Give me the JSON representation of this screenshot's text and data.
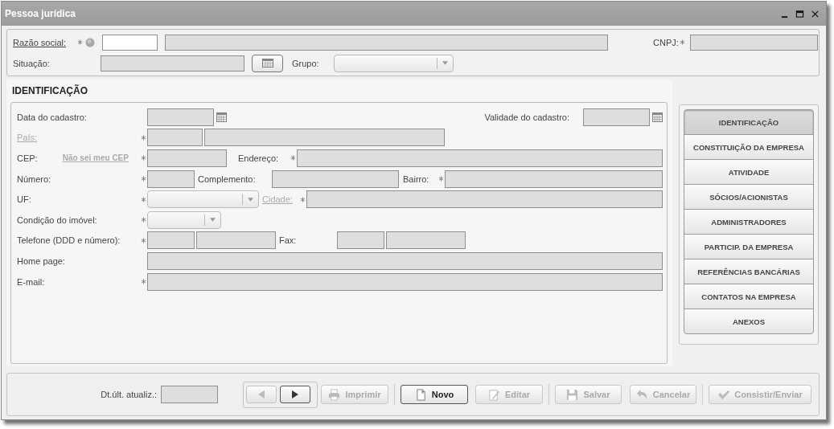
{
  "window": {
    "title": "Pessoa jurídica"
  },
  "header": {
    "razao_social": {
      "label": "Razão social:",
      "link": true,
      "disabled": false,
      "required": true,
      "fields": [
        {
          "kind": "text",
          "disabled": false
        },
        {
          "kind": "text",
          "disabled": true
        }
      ]
    },
    "cnpj": {
      "label": "CNPJ:",
      "link": false,
      "disabled": false,
      "required": true,
      "fields": [
        {
          "kind": "text",
          "disabled": true
        }
      ]
    },
    "situacao": {
      "label": "Situação:",
      "link": false,
      "disabled": false,
      "required": false,
      "fields": [
        {
          "kind": "text",
          "disabled": true
        }
      ]
    },
    "grupo": {
      "label": "Grupo:",
      "link": false,
      "disabled": false,
      "required": false,
      "fields": [
        {
          "kind": "dropdown",
          "disabled": true
        }
      ]
    }
  },
  "identification": {
    "title": "IDENTIFICAÇÃO",
    "registration_date": {
      "label": "Data do cadastro:",
      "link": false,
      "disabled": false,
      "required": false,
      "fields": [
        {
          "kind": "date",
          "disabled": true
        }
      ]
    },
    "validity_date": {
      "label": "Validade do cadastro:",
      "link": false,
      "disabled": false,
      "required": false,
      "fields": [
        {
          "kind": "date",
          "disabled": true
        }
      ]
    },
    "country": {
      "label": "País:",
      "link": true,
      "disabled": true,
      "required": true,
      "fields": [
        {
          "kind": "text",
          "disabled": true
        },
        {
          "kind": "text",
          "disabled": true
        }
      ]
    },
    "cep": {
      "label": "CEP:",
      "link": false,
      "disabled": false,
      "required": true,
      "help_link": {
        "label": "Não sei meu CEP",
        "disabled": true
      },
      "fields": [
        {
          "kind": "text",
          "disabled": true
        }
      ]
    },
    "address": {
      "label": "Endereço:",
      "link": false,
      "disabled": false,
      "required": true,
      "fields": [
        {
          "kind": "text",
          "disabled": true
        }
      ]
    },
    "number": {
      "label": "Número:",
      "link": false,
      "disabled": false,
      "required": true,
      "fields": [
        {
          "kind": "text",
          "disabled": true
        }
      ]
    },
    "complement": {
      "label": "Complemento:",
      "link": false,
      "disabled": false,
      "required": false,
      "fields": [
        {
          "kind": "text",
          "disabled": true
        }
      ]
    },
    "district": {
      "label": "Bairro:",
      "link": false,
      "disabled": false,
      "required": true,
      "fields": [
        {
          "kind": "text",
          "disabled": true
        }
      ]
    },
    "state": {
      "label": "UF:",
      "link": false,
      "disabled": false,
      "required": true,
      "fields": [
        {
          "kind": "dropdown",
          "disabled": true
        }
      ]
    },
    "city": {
      "label": "Cidade:",
      "link": true,
      "disabled": true,
      "required": true,
      "fields": [
        {
          "kind": "text",
          "disabled": true
        }
      ]
    },
    "property": {
      "label": "Condição do imóvel:",
      "link": false,
      "disabled": false,
      "required": true,
      "fields": [
        {
          "kind": "dropdown",
          "disabled": true
        }
      ]
    },
    "phone": {
      "label": "Telefone (DDD e número):",
      "link": false,
      "disabled": false,
      "required": true,
      "fields": [
        {
          "kind": "text",
          "disabled": true
        },
        {
          "kind": "text",
          "disabled": true
        }
      ]
    },
    "fax": {
      "label": "Fax:",
      "link": false,
      "disabled": false,
      "required": false,
      "fields": [
        {
          "kind": "text",
          "disabled": true
        },
        {
          "kind": "text",
          "disabled": true
        }
      ]
    },
    "homepage": {
      "label": "Home page:",
      "link": false,
      "disabled": false,
      "required": false,
      "fields": [
        {
          "kind": "text",
          "disabled": true
        }
      ]
    },
    "email": {
      "label": "E-mail:",
      "link": false,
      "disabled": false,
      "required": true,
      "fields": [
        {
          "kind": "text",
          "disabled": true
        }
      ]
    }
  },
  "nav": [
    {
      "label": "IDENTIFICAÇÃO",
      "selected": true
    },
    {
      "label": "CONSTITUIÇÃO DA EMPRESA",
      "selected": false
    },
    {
      "label": "ATIVIDADE",
      "selected": false
    },
    {
      "label": "SÓCIOS/ACIONISTAS",
      "selected": false
    },
    {
      "label": "ADMINISTRADORES",
      "selected": false
    },
    {
      "label": "PARTICIP. DA EMPRESA",
      "selected": false
    },
    {
      "label": "REFERÊNCIAS BANCÁRIAS",
      "selected": false
    },
    {
      "label": "CONTATOS NA EMPRESA",
      "selected": false
    },
    {
      "label": "ANEXOS",
      "selected": false
    }
  ],
  "footer": {
    "last_update": {
      "label": "Dt.últ. atualiz.:",
      "link": false,
      "disabled": false,
      "required": false,
      "fields": [
        {
          "kind": "text",
          "disabled": true
        }
      ]
    },
    "pager": {
      "previous": {
        "disabled": true
      },
      "next": {
        "disabled": false
      }
    },
    "buttons": [
      {
        "kind": "print",
        "label": "Imprimir",
        "disabled": true
      },
      {
        "kind": "new",
        "label": "Novo",
        "disabled": false
      },
      {
        "kind": "edit",
        "label": "Editar",
        "disabled": true
      },
      {
        "kind": "save",
        "label": "Salvar",
        "disabled": true
      },
      {
        "kind": "cancel",
        "label": "Cancelar",
        "disabled": true
      },
      {
        "kind": "submit",
        "label": "Consistir/Enviar",
        "disabled": true
      }
    ]
  }
}
